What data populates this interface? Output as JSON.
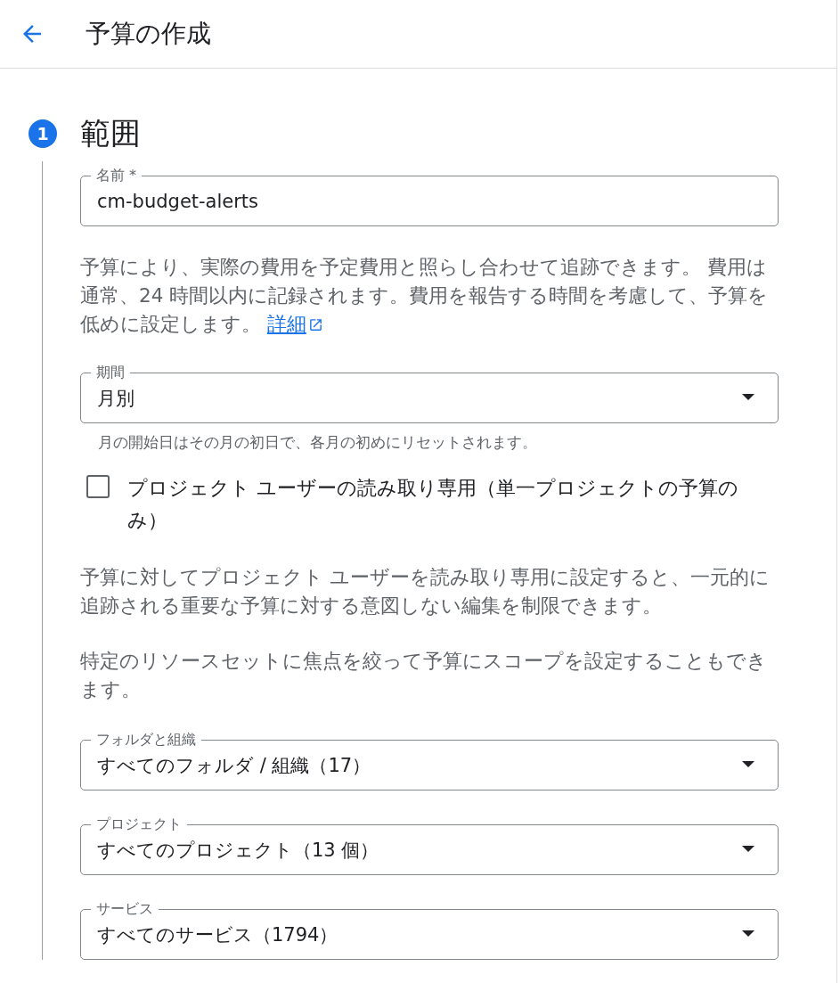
{
  "header": {
    "title": "予算の作成"
  },
  "step": {
    "number": "1",
    "title": "範囲"
  },
  "name_field": {
    "label": "名前 *",
    "value": "cm-budget-alerts"
  },
  "intro": {
    "text": "予算により、実際の費用を予定費用と照らし合わせて追跡できます。 費用は通常、24 時間以内に記録されます。費用を報告する時間を考慮して、予算を低めに設定します。",
    "link": "詳細"
  },
  "period_field": {
    "label": "期間",
    "value": "月別",
    "helper": "月の開始日はその月の初日で、各月の初めにリセットされます。"
  },
  "readonly_checkbox": {
    "label": "プロジェクト ユーザーの読み取り専用（単一プロジェクトの予算のみ）",
    "checked": false
  },
  "paragraphs": [
    "予算に対してプロジェクト ユーザーを読み取り専用に設定すると、一元的に追跡される重要な予算に対する意図しない編集を制限できます。",
    "特定のリソースセットに焦点を絞って予算にスコープを設定することもできます。"
  ],
  "scope_fields": [
    {
      "label": "フォルダと組織",
      "value": "すべてのフォルダ / 組織（17）"
    },
    {
      "label": "プロジェクト",
      "value": "すべてのプロジェクト（13 個）"
    },
    {
      "label": "サービス",
      "value": "すべてのサービス（1794）"
    }
  ]
}
